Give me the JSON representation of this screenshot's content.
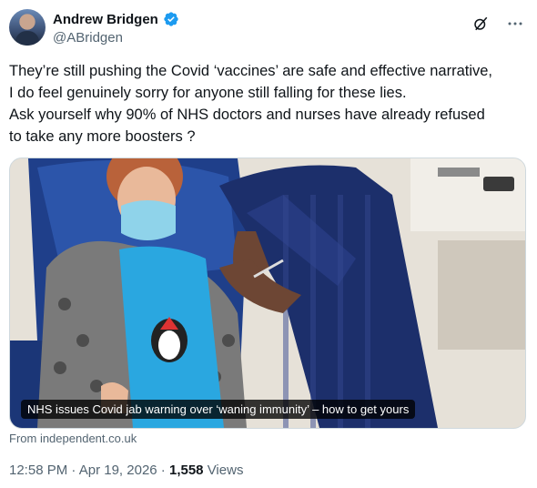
{
  "author": {
    "display_name": "Andrew Bridgen",
    "handle": "@ABridgen",
    "verified": true,
    "verified_color": "#1d9bf0"
  },
  "top_actions": [
    {
      "icon": "grok-slash-circle-icon"
    },
    {
      "icon": "more-dots-icon"
    }
  ],
  "tweet": {
    "lines": [
      "They’re still pushing the Covid ‘vaccines’ are safe and effective narrative,",
      "I do feel genuinely sorry for anyone still falling for these lies.",
      "Ask yourself why 90% of NHS doctors and nurses have already refused",
      "to take any more boosters ?"
    ]
  },
  "media": {
    "caption": "NHS issues Covid jab warning over ‘waning immunity’ – how to get yours"
  },
  "link_source": "From independent.co.uk",
  "meta": {
    "time": "12:58 PM",
    "separator1": " · ",
    "date": "Apr 19, 2026",
    "separator2": " · ",
    "views_count": "1,558",
    "views_label": " Views"
  }
}
